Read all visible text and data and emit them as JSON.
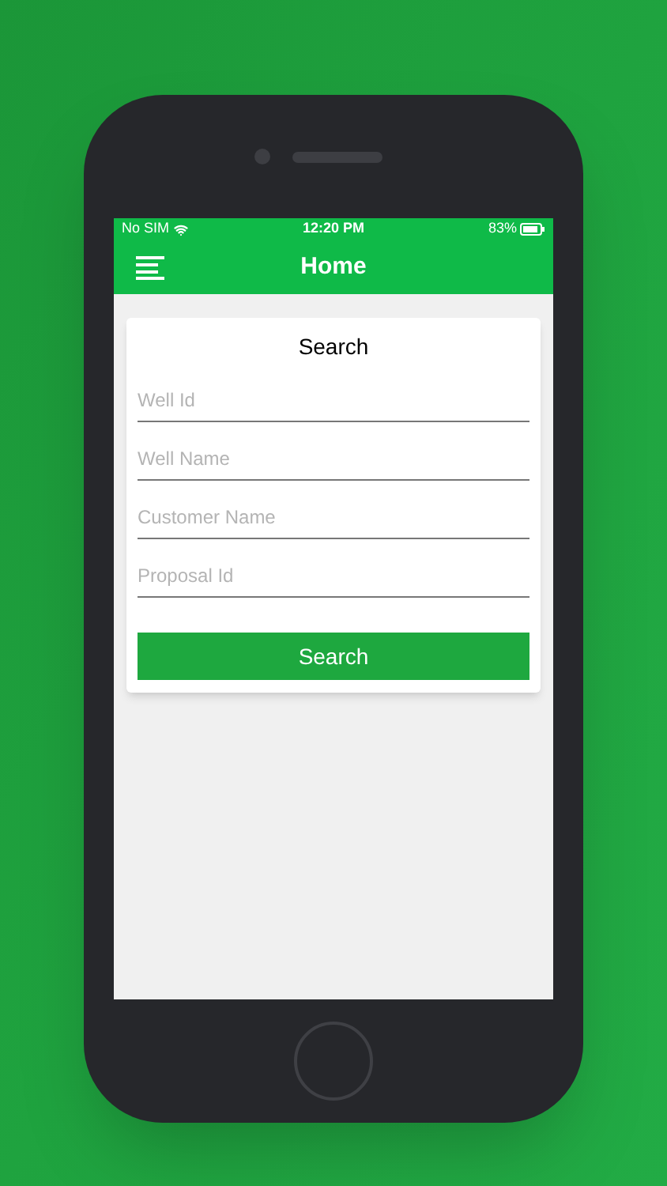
{
  "status_bar": {
    "carrier": "No SIM",
    "time": "12:20 PM",
    "battery": "83%"
  },
  "nav_bar": {
    "title": "Home"
  },
  "search_card": {
    "title": "Search",
    "fields": [
      {
        "placeholder": "Well Id"
      },
      {
        "placeholder": "Well Name"
      },
      {
        "placeholder": "Customer Name"
      },
      {
        "placeholder": "Proposal Id"
      }
    ],
    "button": "Search"
  }
}
